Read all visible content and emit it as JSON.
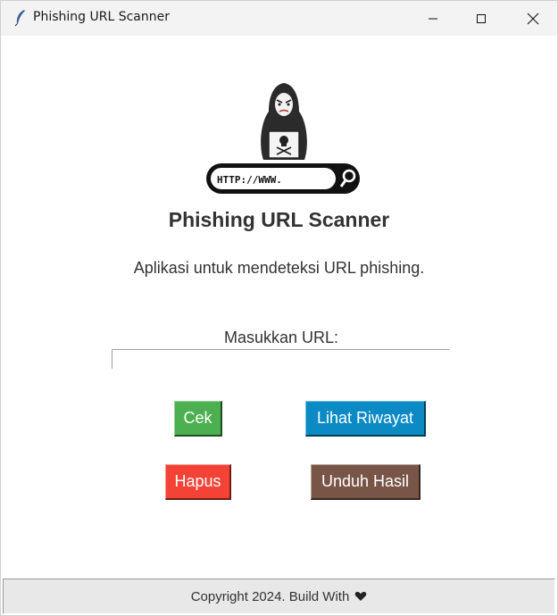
{
  "window": {
    "title": "Phishing URL Scanner",
    "icon": "feather-icon",
    "controls": [
      "minimize-icon",
      "maximize-icon",
      "close-icon"
    ]
  },
  "logo": {
    "icon": "hacker-url-logo",
    "url_text": "HTTP://WWW."
  },
  "main": {
    "heading": "Phishing URL Scanner",
    "subtitle": "Aplikasi untuk mendeteksi URL phishing.",
    "url_label": "Masukkan URL:",
    "url_value": ""
  },
  "buttons": {
    "cek": "Cek",
    "riwayat": "Lihat Riwayat",
    "hapus": "Hapus",
    "unduh": "Unduh Hasil"
  },
  "footer": {
    "text": "Copyright 2024. Build With",
    "icon": "heart-icon"
  },
  "colors": {
    "cek": "#4caf50",
    "riwayat": "#0b8ac4",
    "hapus": "#f44336",
    "unduh": "#795548"
  }
}
